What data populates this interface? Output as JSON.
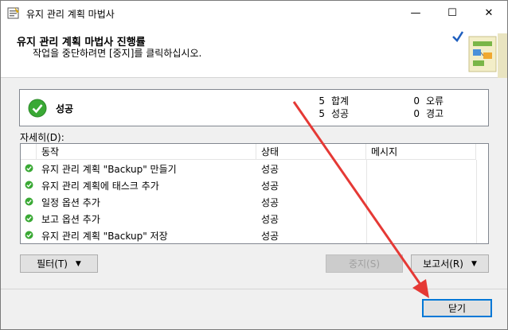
{
  "window": {
    "title": "유지 관리 계획 마법사",
    "minimize_glyph": "—",
    "maximize_glyph": "☐",
    "close_glyph": "✕"
  },
  "header": {
    "title": "유지 관리 계획 마법사 진행률",
    "subtitle": "작업을 중단하려면 [중지]를 클릭하십시오."
  },
  "status": {
    "label": "성공",
    "total_count": "5",
    "total_label": "합계",
    "success_count": "5",
    "success_label": "성공",
    "error_count": "0",
    "error_label": "오류",
    "warning_count": "0",
    "warning_label": "경고"
  },
  "details": {
    "label": "자세히(D):",
    "columns": [
      "동작",
      "상태",
      "메시지"
    ],
    "rows": [
      {
        "action": "유지 관리 계획 \"Backup\" 만들기",
        "status": "성공",
        "message": ""
      },
      {
        "action": "유지 관리 계획에 태스크 추가",
        "status": "성공",
        "message": ""
      },
      {
        "action": "일정 옵션 추가",
        "status": "성공",
        "message": ""
      },
      {
        "action": "보고 옵션 추가",
        "status": "성공",
        "message": ""
      },
      {
        "action": "유지 관리 계획 \"Backup\" 저장",
        "status": "성공",
        "message": ""
      }
    ]
  },
  "buttons": {
    "filter": "필터(T)",
    "stop": "중지(S)",
    "report": "보고서(R)",
    "close": "닫기"
  },
  "icons": {
    "app": "wizard-icon",
    "success": "check-circle-icon",
    "dropdown": "caret-down-icon",
    "annotation": "red-arrow"
  },
  "colors": {
    "success_green": "#3aa935",
    "accent_blue": "#0078d7",
    "annotation_red": "#e53935"
  }
}
